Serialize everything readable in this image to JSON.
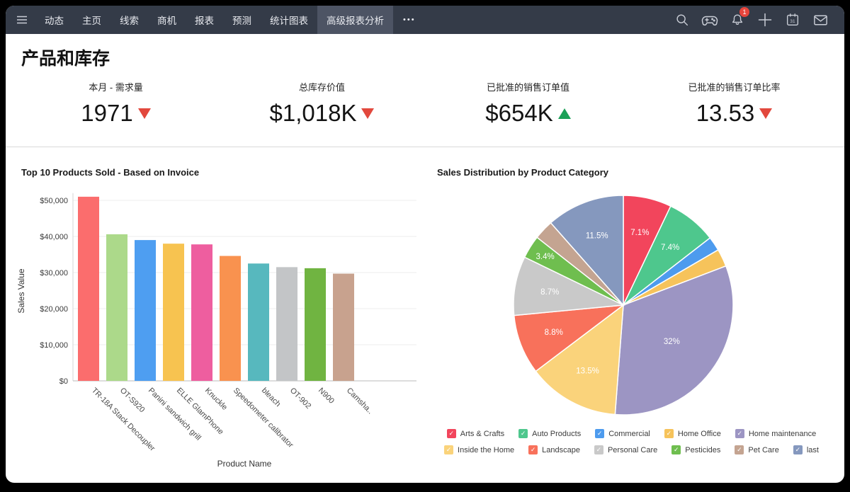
{
  "nav": {
    "items": [
      {
        "label": "动态"
      },
      {
        "label": "主页"
      },
      {
        "label": "线索"
      },
      {
        "label": "商机"
      },
      {
        "label": "报表"
      },
      {
        "label": "预测"
      },
      {
        "label": "统计图表"
      },
      {
        "label": "高级报表分析"
      }
    ],
    "active_index": 7,
    "more_label": "•••",
    "notification_count": "1"
  },
  "page": {
    "title": "产品和库存"
  },
  "kpis": [
    {
      "label": "本月 - 需求量",
      "value": "1971",
      "trend": "down"
    },
    {
      "label": "总库存价值",
      "value": "$1,018K",
      "trend": "down"
    },
    {
      "label": "已批准的销售订单值",
      "value": "$654K",
      "trend": "up"
    },
    {
      "label": "已批准的销售订单比率",
      "value": "13.53",
      "trend": "down"
    }
  ],
  "colors": {
    "navbar_bg": "#343b48",
    "navbar_active_bg": "#4d5464",
    "trend_up": "#1ca158",
    "trend_down": "#e2483d",
    "gridline": "#ececec",
    "axis_line": "#d6d6d6",
    "tick_text": "#3a3a3a"
  },
  "chart_data": [
    {
      "type": "bar",
      "title": "Top 10 Products Sold - Based on Invoice",
      "xlabel": "Product Name",
      "ylabel": "Sales Value",
      "categories": [
        "TR-18A Stack Decoupler",
        "OT-S920",
        "Panini sandwich grill",
        "ELLE GlamPhone",
        "Knuckle",
        "Speedometer calibrator",
        "bleach",
        "OT-902",
        "N900",
        "Camsha.."
      ],
      "values": [
        51000,
        40600,
        39000,
        38000,
        37800,
        34600,
        32500,
        31500,
        31200,
        29700
      ],
      "bar_colors": [
        "#fb6d6d",
        "#acd98a",
        "#4e9ef1",
        "#f7c350",
        "#ee5e9f",
        "#f9924f",
        "#57b8be",
        "#c3c5c7",
        "#70b441",
        "#c8a28e"
      ],
      "ylim": [
        0,
        52000
      ],
      "yticks": [
        "$0",
        "$10,000",
        "$20,000",
        "$30,000",
        "$40,000",
        "$50,000"
      ],
      "ytick_values": [
        0,
        10000,
        20000,
        30000,
        40000,
        50000
      ],
      "grid": true,
      "legend_position": "none"
    },
    {
      "type": "pie",
      "title": "Sales Distribution by Product Category",
      "slices": [
        {
          "name": "Arts & Crafts",
          "pct": 7.1,
          "label": "7.1%",
          "color": "#f2455c"
        },
        {
          "name": "Auto Products",
          "pct": 7.4,
          "label": "7.4%",
          "color": "#4ec78d"
        },
        {
          "name": "Commercial",
          "pct": 2.1,
          "label": null,
          "color": "#4d9bee"
        },
        {
          "name": "Home Office",
          "pct": 2.6,
          "label": null,
          "color": "#f6c35b"
        },
        {
          "name": "Home maintenance",
          "pct": 32.0,
          "label": "32%",
          "color": "#9c95c3"
        },
        {
          "name": "Inside the Home",
          "pct": 13.5,
          "label": "13.5%",
          "color": "#fad37b"
        },
        {
          "name": "Landscape",
          "pct": 8.8,
          "label": "8.8%",
          "color": "#f8715b"
        },
        {
          "name": "Personal Care",
          "pct": 8.7,
          "label": "8.7%",
          "color": "#c9c9c9"
        },
        {
          "name": "Pesticides",
          "pct": 3.4,
          "label": "3.4%",
          "color": "#6fbe4f"
        },
        {
          "name": "Pet Care",
          "pct": 2.9,
          "label": null,
          "color": "#c4a491"
        },
        {
          "name": "last",
          "pct": 11.5,
          "label": "11.5%",
          "color": "#8598be"
        }
      ],
      "legend_position": "bottom",
      "legend_rows": [
        5,
        6
      ]
    }
  ]
}
